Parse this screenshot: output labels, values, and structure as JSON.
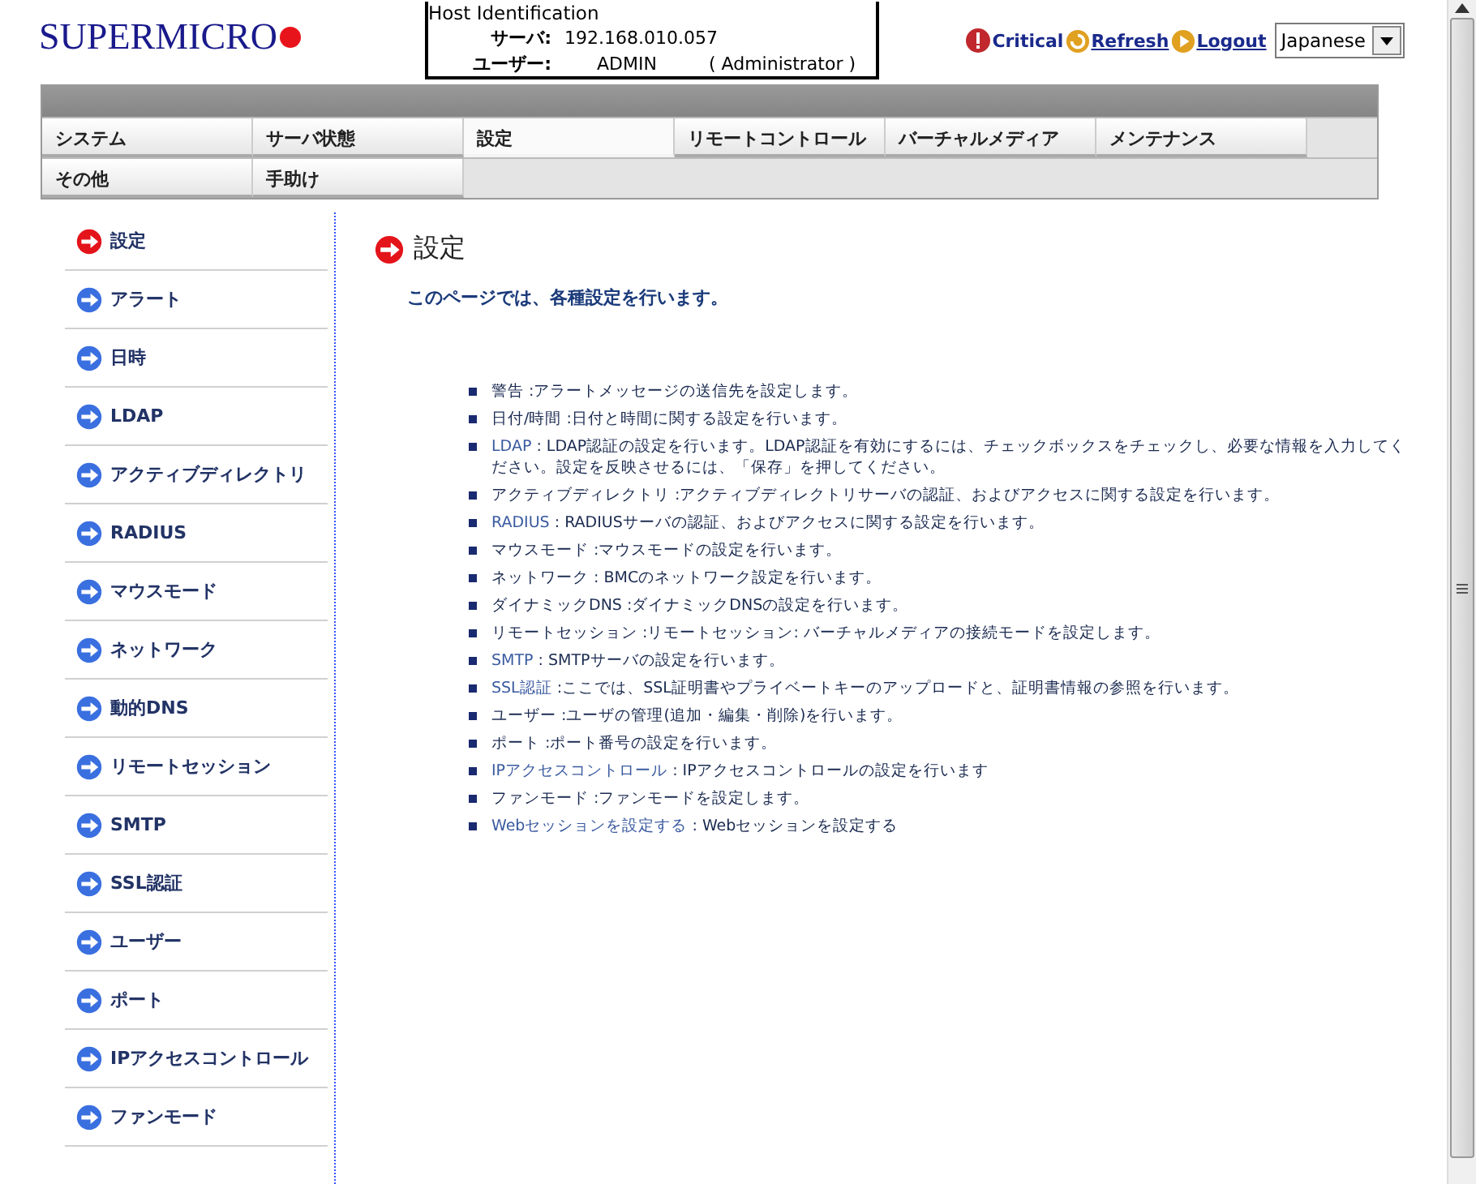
{
  "header": {
    "logo": "SUPERMICRO",
    "host_identification": {
      "legend": "Host Identification",
      "server_label": "サーバ:",
      "server_value": "192.168.010.057",
      "user_label": "ユーザー:",
      "user_value": "ADMIN",
      "user_role": "( Administrator )"
    },
    "status": "Critical",
    "refresh": "Refresh",
    "logout": "Logout",
    "language": "Japanese"
  },
  "menu": [
    [
      {
        "label": "システム",
        "selected": false
      },
      {
        "label": "サーバ状態",
        "selected": false
      },
      {
        "label": "設定",
        "selected": true
      },
      {
        "label": "リモートコントロール",
        "selected": false
      },
      {
        "label": "バーチャルメディア",
        "selected": false
      },
      {
        "label": "メンテナンス",
        "selected": false
      }
    ],
    [
      {
        "label": "その他",
        "selected": false
      },
      {
        "label": "手助け",
        "selected": false
      }
    ]
  ],
  "sidebar": {
    "items": [
      {
        "label": "設定",
        "selected": true
      },
      {
        "label": "アラート",
        "selected": false
      },
      {
        "label": "日時",
        "selected": false
      },
      {
        "label": "LDAP",
        "selected": false
      },
      {
        "label": "アクティブディレクトリ",
        "selected": false
      },
      {
        "label": "RADIUS",
        "selected": false
      },
      {
        "label": "マウスモード",
        "selected": false
      },
      {
        "label": "ネットワーク",
        "selected": false
      },
      {
        "label": "動的DNS",
        "selected": false
      },
      {
        "label": "リモートセッション",
        "selected": false
      },
      {
        "label": "SMTP",
        "selected": false
      },
      {
        "label": "SSL認証",
        "selected": false
      },
      {
        "label": "ユーザー",
        "selected": false
      },
      {
        "label": "ポート",
        "selected": false
      },
      {
        "label": "IPアクセスコントロール",
        "selected": false
      },
      {
        "label": "ファンモード",
        "selected": false
      }
    ]
  },
  "content": {
    "title": "設定",
    "intro": "このページでは、各種設定を行います。",
    "items": [
      {
        "term": "警告",
        "link": false,
        "description": ":アラートメッセージの送信先を設定します。"
      },
      {
        "term": "日付/時間",
        "link": false,
        "description": ":日付と時間に関する設定を行います。"
      },
      {
        "term": "LDAP",
        "link": true,
        "description": ": LDAP認証の設定を行います。LDAP認証を有効にするには、チェックボックスをチェックし、必要な情報を入力してください。設定を反映させるには、「保存」を押してください。"
      },
      {
        "term": "アクティブディレクトリ",
        "link": false,
        "description": ":アクティブディレクトリサーバの認証、およびアクセスに関する設定を行います。"
      },
      {
        "term": "RADIUS",
        "link": true,
        "description": ": RADIUSサーバの認証、およびアクセスに関する設定を行います。"
      },
      {
        "term": "マウスモード",
        "link": false,
        "description": ":マウスモードの設定を行います。"
      },
      {
        "term": "ネットワーク",
        "link": false,
        "description": ": BMCのネットワーク設定を行います。"
      },
      {
        "term": "ダイナミックDNS",
        "link": false,
        "description": ":ダイナミックDNSの設定を行います。"
      },
      {
        "term": "リモートセッション",
        "link": false,
        "description": ":リモートセッション: バーチャルメディアの接続モードを設定します。"
      },
      {
        "term": "SMTP",
        "link": true,
        "description": ": SMTPサーバの設定を行います。"
      },
      {
        "term": "SSL認証",
        "link": true,
        "description": ":ここでは、SSL証明書やプライベートキーのアップロードと、証明書情報の参照を行います。"
      },
      {
        "term": "ユーザー",
        "link": false,
        "description": ":ユーザの管理(追加・編集・削除)を行います。"
      },
      {
        "term": "ポート",
        "link": false,
        "description": ":ポート番号の設定を行います。"
      },
      {
        "term": "IPアクセスコントロール",
        "link": true,
        "description": ": IPアクセスコントロールの設定を行います"
      },
      {
        "term": "ファンモード",
        "link": false,
        "description": ":ファンモードを設定します。"
      },
      {
        "term": "Webセッションを設定する",
        "link": true,
        "description": ": Webセッションを設定する"
      }
    ]
  }
}
